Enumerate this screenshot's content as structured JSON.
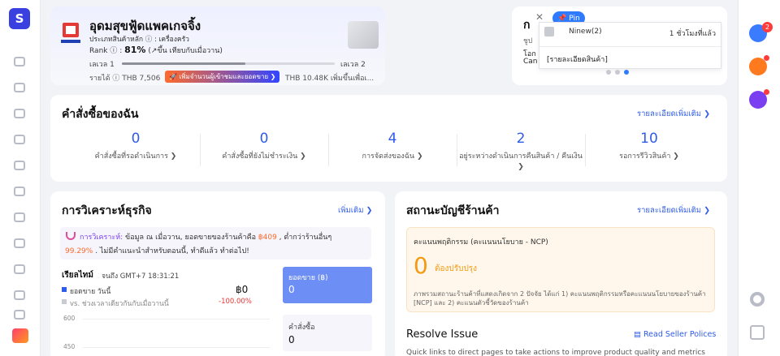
{
  "brand": {
    "logo_letter": "S"
  },
  "shop": {
    "name": "อุดมสุขฟู้ดแพคเกจจิ้ง",
    "category": "ประเภทสินค้าหลัก ⓘ : เครื่องครัว",
    "rank_label": "Rank ⓘ :",
    "rank_value": "81%",
    "rank_change": "(↗ขึ้น เทียบกับเมื่อวาน)",
    "level_start": "เลเวล 1",
    "level_end": "เลเวล 2",
    "level_progress": 0.58,
    "income_text": "รายได้ ⓘ  THB 7,506",
    "boost_label": "🚀 เพิ่มจำนวนผู้เข้าชมและยอดขาย ❯",
    "income_target": "THB 10.48K เพิ่มขึ้นเพื่อเ..."
  },
  "notification": {
    "title": "ก",
    "subtitle": "ชูป",
    "line1": "โอก",
    "line2": "Can",
    "pin_label": "Pin",
    "popup": {
      "sender": "Ninew(2)",
      "time": "1 ชั่วโมงที่แล้ว",
      "link": "[รายละเอียดสินค้า]"
    },
    "page_dots": 3,
    "active_dot": 3
  },
  "orders": {
    "title": "คำสั่งซื้อของฉัน",
    "more_link": "รายละเอียดเพิ่มเติม ❯",
    "stats": [
      {
        "value": "0",
        "label": "คำสั่งซื้อที่รอดำเนินการ ❯"
      },
      {
        "value": "0",
        "label": "คำสั่งซื้อที่ยังไม่ชำระเงิน ❯"
      },
      {
        "value": "4",
        "label": "การจัดส่งของฉัน ❯"
      },
      {
        "value": "2",
        "label": "อยู่ระหว่างดำเนินการคืนสินค้า / คืนเงิน ❯"
      },
      {
        "value": "10",
        "label": "รอการรีวิวสินค้า ❯"
      }
    ]
  },
  "business": {
    "title": "การวิเคราะห์ธุรกิจ",
    "more_link": "เพิ่มเติม ❯",
    "tip_prefix": "การวิเคราะห์:",
    "tip_text1": " ข้อมูล ณ เมื่อวาน, ยอดขายของร้านค้าคือ ",
    "tip_amount": "฿409",
    "tip_text2": " , ต่ำกว่าร้านอื่นๆ",
    "tip_percent": "99.29%",
    "tip_text3": " . ไม่มีคำแนะนำสำหรับตอนนี้, ทำดีแล้ว ทำต่อไป!",
    "realtime_label": "เรียลไทม์",
    "realtime_time": "จนถึง GMT+7 18:31:21",
    "legend_today": "ยอดขาย วันนี้",
    "legend_compare": "vs. ช่วงเวลาเดียวกันกับเมื่อวานนี้",
    "sales_value": "฿0",
    "sales_change": "-100.00%",
    "sales_box_label": "ยอดขาย (฿)",
    "sales_box_value": "0",
    "orders_box_label": "คำสั่งซื้อ",
    "orders_box_value": "0",
    "y_ticks": [
      "600",
      "450"
    ],
    "colors": {
      "today": "#2f5bea",
      "compare": "#c9cbd2"
    }
  },
  "account": {
    "title": "สถานะบัญชีร้านค้า",
    "more_link": "รายละเอียดเพิ่มเติม ❯",
    "ncp_title": "คะแนนพฤติกรรม (คะแนนนโยบาย - NCP)",
    "ncp_value": "0",
    "ncp_label": "ต้องปรับปรุง",
    "ncp_desc": "ภาพรวมสถานะร้านค้าที่แสดงเกิดจาก 2 ปัจจัย ได้แก่ 1) คะแนนพฤติกรรมหรือคะแนนนโยบายของร้านค้า [NCP] และ 2) คะแนนตัวชี้วัดของร้านค้า",
    "resolve_title": "Resolve Issue",
    "resolve_link": "Read Seller Polices",
    "resolve_desc": "Quick links to direct pages to take actions to improve product quality and metrics"
  },
  "right_bar": {
    "chat_badge": "2"
  }
}
